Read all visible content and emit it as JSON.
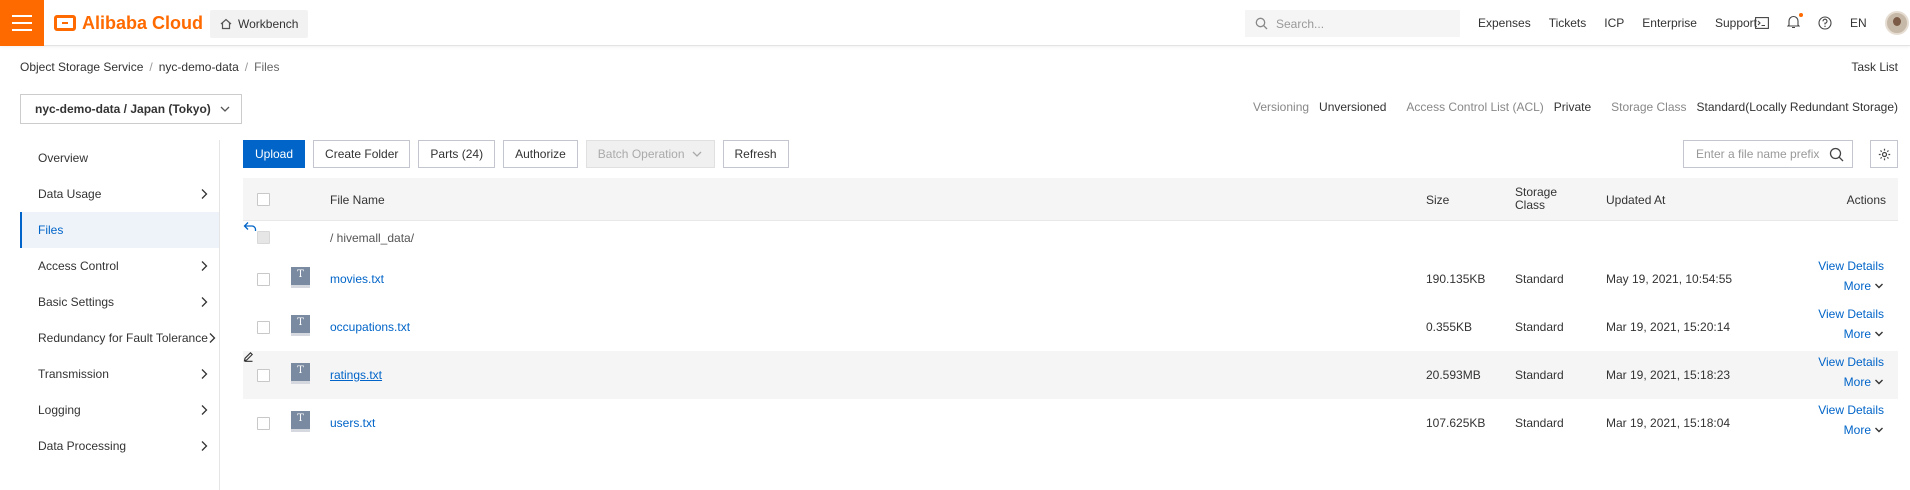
{
  "header": {
    "brand": "Alibaba Cloud",
    "workbench": "Workbench",
    "search_placeholder": "Search...",
    "links": [
      "Expenses",
      "Tickets",
      "ICP",
      "Enterprise",
      "Support"
    ],
    "language": "EN"
  },
  "breadcrumb": {
    "items": [
      "Object Storage Service",
      "nyc-demo-data",
      "Files"
    ],
    "separator": "/"
  },
  "task_list": "Task List",
  "bucket": {
    "selector": "nyc-demo-data / Japan (Tokyo)",
    "versioning_label": "Versioning",
    "versioning_value": "Unversioned",
    "acl_label": "Access Control List (ACL)",
    "acl_value": "Private",
    "storage_label": "Storage Class",
    "storage_value": "Standard(Locally Redundant Storage)"
  },
  "sidebar": {
    "items": [
      {
        "label": "Overview",
        "expandable": false
      },
      {
        "label": "Data Usage",
        "expandable": true
      },
      {
        "label": "Files",
        "expandable": false,
        "active": true
      },
      {
        "label": "Access Control",
        "expandable": true
      },
      {
        "label": "Basic Settings",
        "expandable": true
      },
      {
        "label": "Redundancy for Fault Tolerance",
        "expandable": true
      },
      {
        "label": "Transmission",
        "expandable": true
      },
      {
        "label": "Logging",
        "expandable": true
      },
      {
        "label": "Data Processing",
        "expandable": true
      }
    ]
  },
  "toolbar": {
    "upload": "Upload",
    "create_folder": "Create Folder",
    "parts": "Parts (24)",
    "authorize": "Authorize",
    "batch_operation": "Batch Operation",
    "refresh": "Refresh",
    "prefix_placeholder": "Enter a file name prefix"
  },
  "table": {
    "columns": {
      "file_name": "File Name",
      "size": "Size",
      "storage_class": "Storage Class",
      "updated_at": "Updated At",
      "actions": "Actions"
    },
    "current_path": "/ hivemall_data/",
    "rows": [
      {
        "icon": "T",
        "name": "movies.txt",
        "size": "190.135KB",
        "storage_class": "Standard",
        "updated_at": "May 19, 2021, 10:54:55",
        "view": "View Details",
        "more": "More"
      },
      {
        "icon": "T",
        "name": "occupations.txt",
        "size": "0.355KB",
        "storage_class": "Standard",
        "updated_at": "Mar 19, 2021, 15:20:14",
        "view": "View Details",
        "more": "More"
      },
      {
        "icon": "T",
        "name": "ratings.txt",
        "size": "20.593MB",
        "storage_class": "Standard",
        "updated_at": "Mar 19, 2021, 15:18:23",
        "view": "View Details",
        "more": "More"
      },
      {
        "icon": "T",
        "name": "users.txt",
        "size": "107.625KB",
        "storage_class": "Standard",
        "updated_at": "Mar 19, 2021, 15:18:04",
        "view": "View Details",
        "more": "More"
      }
    ]
  },
  "colors": {
    "brand": "#ff6a00",
    "primary": "#0064c8",
    "hover_row": "#f5f5f6"
  }
}
